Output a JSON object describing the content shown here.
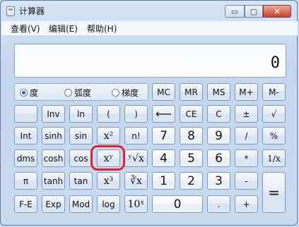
{
  "window": {
    "title": "计算器",
    "min_glyph": "▭",
    "max_glyph": "▢",
    "close_glyph": "✕"
  },
  "menu": {
    "view": "查看(V)",
    "edit": "编辑(E)",
    "help": "帮助(H)"
  },
  "display": {
    "value": "0"
  },
  "angle": {
    "deg": "度",
    "rad": "弧度",
    "grad": "梯度",
    "selected": "度"
  },
  "keys": {
    "mc": "MC",
    "mr": "MR",
    "ms": "MS",
    "mplus": "M+",
    "mminus": "M-",
    "inv": "Inv",
    "ln": "ln",
    "lparen": "(",
    "rparen": ")",
    "back": "⟵",
    "ce": "CE",
    "c": "C",
    "plusminus": "±",
    "sqrt": "√",
    "int": "Int",
    "sinh": "sinh",
    "sin": "sin",
    "x2": "x²",
    "fact": "n!",
    "n7": "7",
    "n8": "8",
    "n9": "9",
    "div": "/",
    "pct": "%",
    "dms": "dms",
    "cosh": "cosh",
    "cos": "cos",
    "xy": "xʸ",
    "yrootx": "ʸ√x",
    "n4": "4",
    "n5": "5",
    "n6": "6",
    "mul": "*",
    "recip": "1/x",
    "pi": "π",
    "tanh": "tanh",
    "tan": "tan",
    "x3": "x³",
    "cbrt": "∛x",
    "n1": "1",
    "n2": "2",
    "n3": "3",
    "sub": "-",
    "eq": "=",
    "fe": "F-E",
    "exp": "Exp",
    "mod": "Mod",
    "log": "log",
    "tenx": "10ˣ",
    "n0": "0",
    "dot": ".",
    "add": "+"
  }
}
